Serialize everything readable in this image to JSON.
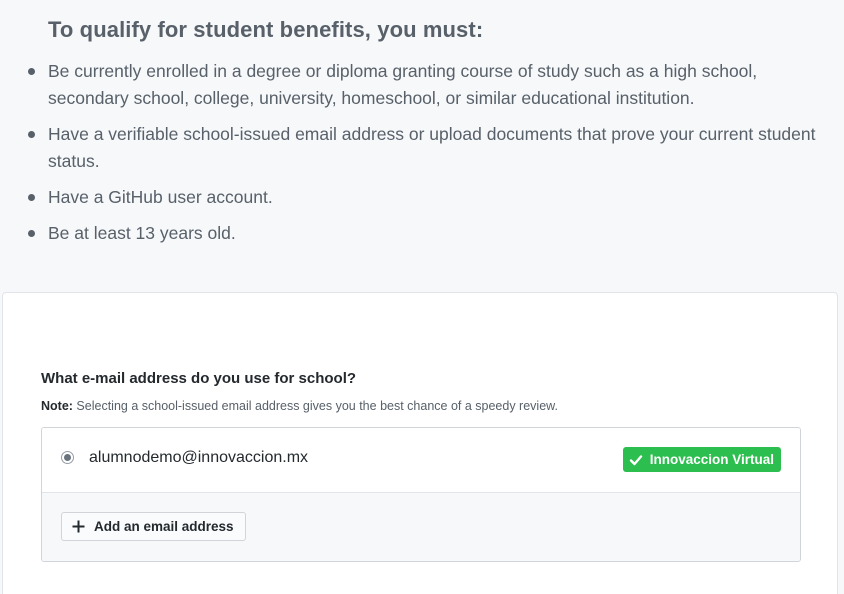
{
  "requirements": {
    "heading": "To qualify for student benefits, you must:",
    "items": [
      {
        "text": "Be currently enrolled in a degree or diploma granting course of study such as a high school, secondary school, college, university, homeschool, or similar educational institution."
      },
      {
        "text": "Have a verifiable school-issued email address or upload documents that prove your current student status."
      },
      {
        "text": "Have a GitHub user account."
      },
      {
        "text": "Be at least 13 years old."
      }
    ]
  },
  "email_form": {
    "question": "What e-mail address do you use for school?",
    "note_label": "Note:",
    "note_text": " Selecting a school-issued email address gives you the best chance of a speedy review.",
    "emails": [
      {
        "address": "alumnodemo@innovaccion.mx",
        "selected": true,
        "school_name": "Innovaccion Virtual",
        "verified_icon": "check-icon"
      }
    ],
    "add_button_label": "Add an email address",
    "add_button_icon": "plus-icon"
  },
  "colors": {
    "page_background": "#f6f8fa",
    "verified_badge": "#2cbe4e",
    "muted_text": "#586069",
    "primary_text": "#24292e"
  }
}
